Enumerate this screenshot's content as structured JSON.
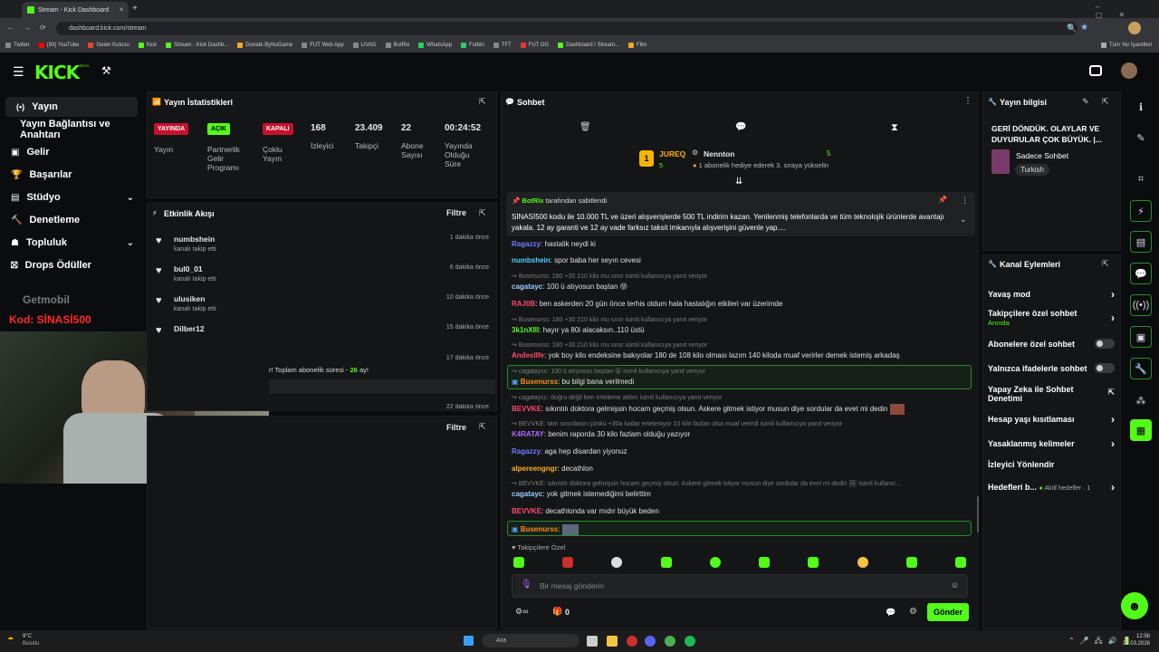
{
  "browser": {
    "tab_title": "Stream - Kick Dashboard",
    "url": "dashboard.kick.com/stream",
    "bookmarks": [
      "Twitter",
      "(93) YouTube",
      "Gelen Kutusu",
      "Kick",
      "Stream - Kick Dashb...",
      "Donate ByNoGame",
      "FUT Web App",
      "LIVAD",
      "BotRix",
      "WhatsApp",
      "Futbin",
      "TFT",
      "FUT GG",
      "Dashboard / Stream...",
      "Film"
    ],
    "all_bookmarks": "Tüm Yer İşaretleri"
  },
  "kick": {
    "logo": "KICK",
    "beta": "BETA"
  },
  "sidebar": {
    "items": [
      {
        "label": "Yayın",
        "icon": "radio-icon"
      },
      {
        "label": "Yayın Bağlantısı ve Anahtarı",
        "icon": ""
      },
      {
        "label": "Gelir",
        "icon": "dollar-icon"
      },
      {
        "label": "Başarılar",
        "icon": "trophy-icon"
      },
      {
        "label": "Stüdyo",
        "icon": "studio-icon"
      },
      {
        "label": "Denetleme",
        "icon": "gavel-icon"
      },
      {
        "label": "Topluluk",
        "icon": "community-icon"
      },
      {
        "label": "Drops Ödüller",
        "icon": "gift-icon"
      }
    ],
    "overlay_brand": "Getmobil",
    "overlay_code": "Kod: SİNASİ500"
  },
  "stats": {
    "title": "Yayın İstatistikleri",
    "badges": [
      {
        "label": "YAYINDA",
        "caption": "Yayın",
        "color": "#c8102e"
      },
      {
        "label": "AÇIK",
        "caption": "Partnerlik Gelir Programı",
        "color": "#53fc18"
      },
      {
        "label": "KAPALI",
        "caption": "Çoklu Yayın",
        "color": "#c8102e"
      }
    ],
    "numbers": [
      {
        "value": "168",
        "caption": "İzleyici"
      },
      {
        "value": "23.409",
        "caption": "Takipçi"
      },
      {
        "value": "22",
        "caption": "Abone Sayısı"
      },
      {
        "value": "00:24:52",
        "caption": "Yayında Olduğu Süre"
      }
    ]
  },
  "activity": {
    "title": "Etkinlik Akışı",
    "filter": "Filtre",
    "items": [
      {
        "name": "numbshein",
        "action": "kanalı takip etti",
        "time": "1 dakika önce"
      },
      {
        "name": "bul0_01",
        "action": "kanalı takip etti",
        "time": "6 dakika önce"
      },
      {
        "name": "ulusiken",
        "action": "kanalı takip etti",
        "time": "10 dakika önce"
      },
      {
        "name": "Dilber12",
        "action": "",
        "time": "15 dakika önce"
      }
    ],
    "partial_time": "17 dakika önce",
    "partial_text": "r! Toplam abonelik süresi -",
    "partial_count": "26",
    "partial_tail": "ay!",
    "partial_time2": "22 dakika önce"
  },
  "bottom_panel": {
    "filter": "Filtre"
  },
  "chat": {
    "title": "Sohbet",
    "leader1": {
      "name": "JUREQ",
      "count": "5",
      "rank": "1"
    },
    "leader2": {
      "name": "Nennton",
      "count": "5",
      "note": "1 abonelik hediye ederek 3. sıraya yükselin"
    },
    "pinned": {
      "user": "BotRix",
      "tag": "tarafından sabitlendi",
      "text": "SİNASİ500 kodu ile 10.000 TL ve üzeri alışverişlerde 500 TL indirim kazan.  Yenilenmiş telefonlarda ve tüm teknolojik ürünlerde avantajı yakala. 12 ay garanti ve 12 ay vade farksız taksit imkanıyla alışverişini güvenle yap...."
    },
    "messages": [
      {
        "reply": "",
        "user": "Ragazzy",
        "color": "#6e7cff",
        "text": "hastalik neydi ki"
      },
      {
        "reply": "",
        "user": "numbshein",
        "color": "#4fd1ff",
        "text": "spor baba her seyın cevesi"
      },
      {
        "reply": "Busenurss: 180 +30 210 kilo mu sınır isimli kullanıcıya yanıt veriyor",
        "user": "cagatayc",
        "color": "#9ad0ff",
        "text": "100 ü atıyosun baştan 😝"
      },
      {
        "reply": "",
        "user": "RAJ0B",
        "color": "#ff4a6e",
        "text": "ben askerden 20 gün önce terhis oldum hala hastalığın etkileri var üzerimde"
      },
      {
        "reply": "Busenurss: 180 +30 210 kilo mu sınır isimli kullanıcıya yanıt veriyor",
        "user": "3k1nXIII",
        "color": "#53fc18",
        "text": "hayır ya 80i alacaksın..110 üstü"
      },
      {
        "reply": "Busenurss: 180 +30 210 kilo mu sınır isimli kullanıcıya yanıt veriyor",
        "user": "Andesllfe",
        "color": "#ff4a6e",
        "text": "yok boy kilo endeksine bakıyolar 180 de 108 kilo olması lazım 140 kiloda muaf verirler demek istemiş arkadaş"
      },
      {
        "reply": "cagataycc: 100 ü atıyosun baştan 😝 isimli kullanıcıya yanıt veriyor",
        "user": "Busenurss",
        "color": "#ff8c1a",
        "text": "bu bilgi bana verilmedi",
        "highlight": true
      },
      {
        "reply": "cagataycc: doğru değil ben erteleme aldım isimli kullanıcıya yanıt veriyor",
        "user": "BEVVKE",
        "color": "#ff4a6e",
        "text": "sıkıntılı doktora gelmişsin hocam geçmiş olsun. Askere gitmek istiyor musun diye sordular da evet mi dedin"
      },
      {
        "reply": "BEVVKE: tam sınırdasın çünkü +30a kadar erteleniyor 10 kilo fazlan olsa muaf verirdi isimli kullanıcıya yanıt veriyor",
        "user": "K4RATAY",
        "color": "#b066ff",
        "text": "benim raporda 30 kilo fazlam olduğu yazıyor"
      },
      {
        "reply": "",
        "user": "Ragazzy",
        "color": "#6e7cff",
        "text": "aga hep disardan yiyonuz"
      },
      {
        "reply": "",
        "user": "alpereengngr",
        "color": "#ffb020",
        "text": "decathlon"
      },
      {
        "reply": "BEVVKE: sıkıntılı doktora gelmişsin hocam geçmiş olsun. Askere gitmek istiyor musun diye sordular da evet mi dedin 🖼 isimli kullanıc...",
        "user": "cagatayc",
        "color": "#9ad0ff",
        "text": "yok gitmek istemediğimi belirttim"
      },
      {
        "reply": "",
        "user": "BEVVKE",
        "color": "#ff4a6e",
        "text": "decathlonda var mıdır büyük beden"
      },
      {
        "reply": "",
        "user": "Busenurss",
        "color": "#ff8c1a",
        "text": "",
        "highlight": true
      }
    ],
    "followers_only": "Takipçilere Özel",
    "input_placeholder": "Bir mesaj gönderin",
    "gift_count": "0",
    "send": "Gönder"
  },
  "stream_info": {
    "title": "Yayın bilgisi",
    "stream_title": "GERİ DÖNDÜK. OLAYLAR VE DUYURULAR ÇOK BÜYÜK. |...",
    "category": "Sadece Sohbet",
    "language": "Turkish"
  },
  "channel_actions": {
    "title": "Kanal Eylemleri",
    "items": [
      {
        "label": "Yavaş mod",
        "sub": "",
        "control": "chevron"
      },
      {
        "label": "Takipçilere özel sohbet",
        "sub": "Anında",
        "control": "chevron"
      },
      {
        "label": "Abonelere özel sohbet",
        "sub": "",
        "control": "toggle"
      },
      {
        "label": "Yalnızca ifadelerle sohbet",
        "sub": "",
        "control": "toggle"
      },
      {
        "label": "Yapay Zeka ile Sohbet Denetimi",
        "sub": "",
        "control": "external"
      },
      {
        "label": "Hesap yaşı kısıtlaması",
        "sub": "",
        "control": "chevron"
      },
      {
        "label": "Yasaklanmış kelimeler",
        "sub": "",
        "control": "chevron"
      },
      {
        "label": "İzleyici Yönlendir",
        "sub": "",
        "control": "none"
      },
      {
        "label": "Hedefleri b...",
        "sub": "Aktif hedefler · 1",
        "control": "chevron"
      }
    ]
  },
  "taskbar": {
    "weather_temp": "9°C",
    "weather_text": "Bulutlu",
    "search": "Ara",
    "time": "12:56",
    "date": "23.03.2026"
  },
  "colors": {
    "brand": "#53fc18",
    "live": "#c8102e",
    "panel": "#141517",
    "bg": "#0b0c0d"
  }
}
